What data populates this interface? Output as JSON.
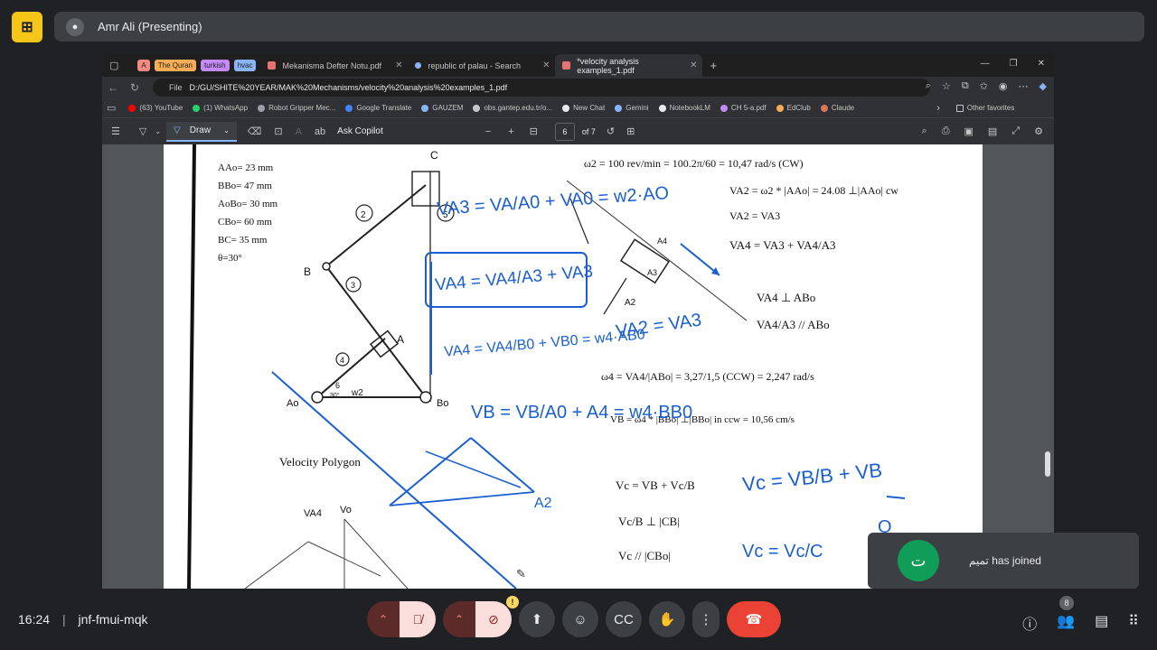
{
  "meet": {
    "presenter": "Amr Ali (Presenting)",
    "time": "16:24",
    "meeting_code": "jnf-fmui-mqk",
    "participants_count": "8",
    "join_notice_name": "تميم",
    "join_notice_text": "has joined",
    "join_avatar_letter": "ت"
  },
  "browser": {
    "tab_groups": [
      {
        "label": "A",
        "color": "#f28b82"
      },
      {
        "label": "The Quran",
        "color": "#f6ad55"
      },
      {
        "label": "turkish",
        "color": "#c58af9"
      },
      {
        "label": "hvac",
        "color": "#8ab4f8"
      }
    ],
    "tabs": [
      {
        "label": "Mekanisma Defter Notu.pdf"
      },
      {
        "label": "republic of palau - Search"
      },
      {
        "label": "*velocity analysis examples_1.pdf"
      }
    ],
    "address_label": "File",
    "url": "D:/GU/SHITE%20YEAR/MAK%20Mechanisms/velocity%20analysis%20examples_1.pdf",
    "bookmarks": [
      "(63) YouTube",
      "(1) WhatsApp",
      "Robot Gripper Mec...",
      "Google Translate",
      "GAUZEM",
      "obs.gantep.edu.tr/o...",
      "New Chat",
      "Gemini",
      "NotebookLM",
      "CH 5-a.pdf",
      "EdClub",
      "Claude"
    ],
    "other_favorites": "Other favorites"
  },
  "pdf": {
    "draw_label": "Draw",
    "ask_copilot": "Ask Copilot",
    "page_number": "6",
    "page_total": "of 7"
  },
  "notes": {
    "given": [
      "AAo= 23 mm",
      "BBo= 47 mm",
      "AoBo= 30 mm",
      "CBo= 60 mm",
      "BC= 35 mm",
      "θ=30°"
    ],
    "eq_w2": "ω2 = 100 rev/min = 100.2π/60 = 10,47 rad/s (CW)",
    "eq_va2": "VA2 = ω2 * |AAo| = 24.08 ⊥|AAo| cw",
    "eq_va2a3": "VA2 = VA3",
    "eq_va4": "VA4 = VA3 + VA4/A3",
    "eq_perp": "VA4 ⊥ ABo",
    "eq_par": "VA4/A3 // ABo",
    "eq_w4": "ω4 = VA4/|ABo| = 3,27/1,5 (CCW) = 2,247 rad/s",
    "eq_vb": "VB = ω4 * |BBo| ⊥|BBo| in ccw = 10,56 cm/s",
    "eq_vc": "Vc = VB + Vc/B",
    "eq_vcb": "Vc/B ⊥ |CB|",
    "eq_vc2": "Vc // |CBo|",
    "polygon_label": "Velocity Polygon",
    "blue_1": "VA3 = VA/A0 + VA0 = w2·AO",
    "blue_2": "VA4 = VA4/A3 + VA3",
    "blue_3": "VA4 = VA4/B0 + VB0 = w4·AB0",
    "blue_4": "VA2 = VA3",
    "blue_5": "VB = VB/A0 + A4 = w4·BB0",
    "blue_6": "Vc = VB/B + VB",
    "blue_7": "Vc = Vc/C",
    "diagram_labels": [
      "C",
      "B",
      "A",
      "Ao",
      "Bo",
      "A4",
      "A3",
      "A2",
      "VA4",
      "Vo",
      "A2",
      "2",
      "3",
      "4",
      "5",
      "6",
      "w2",
      "30°",
      "O"
    ]
  }
}
